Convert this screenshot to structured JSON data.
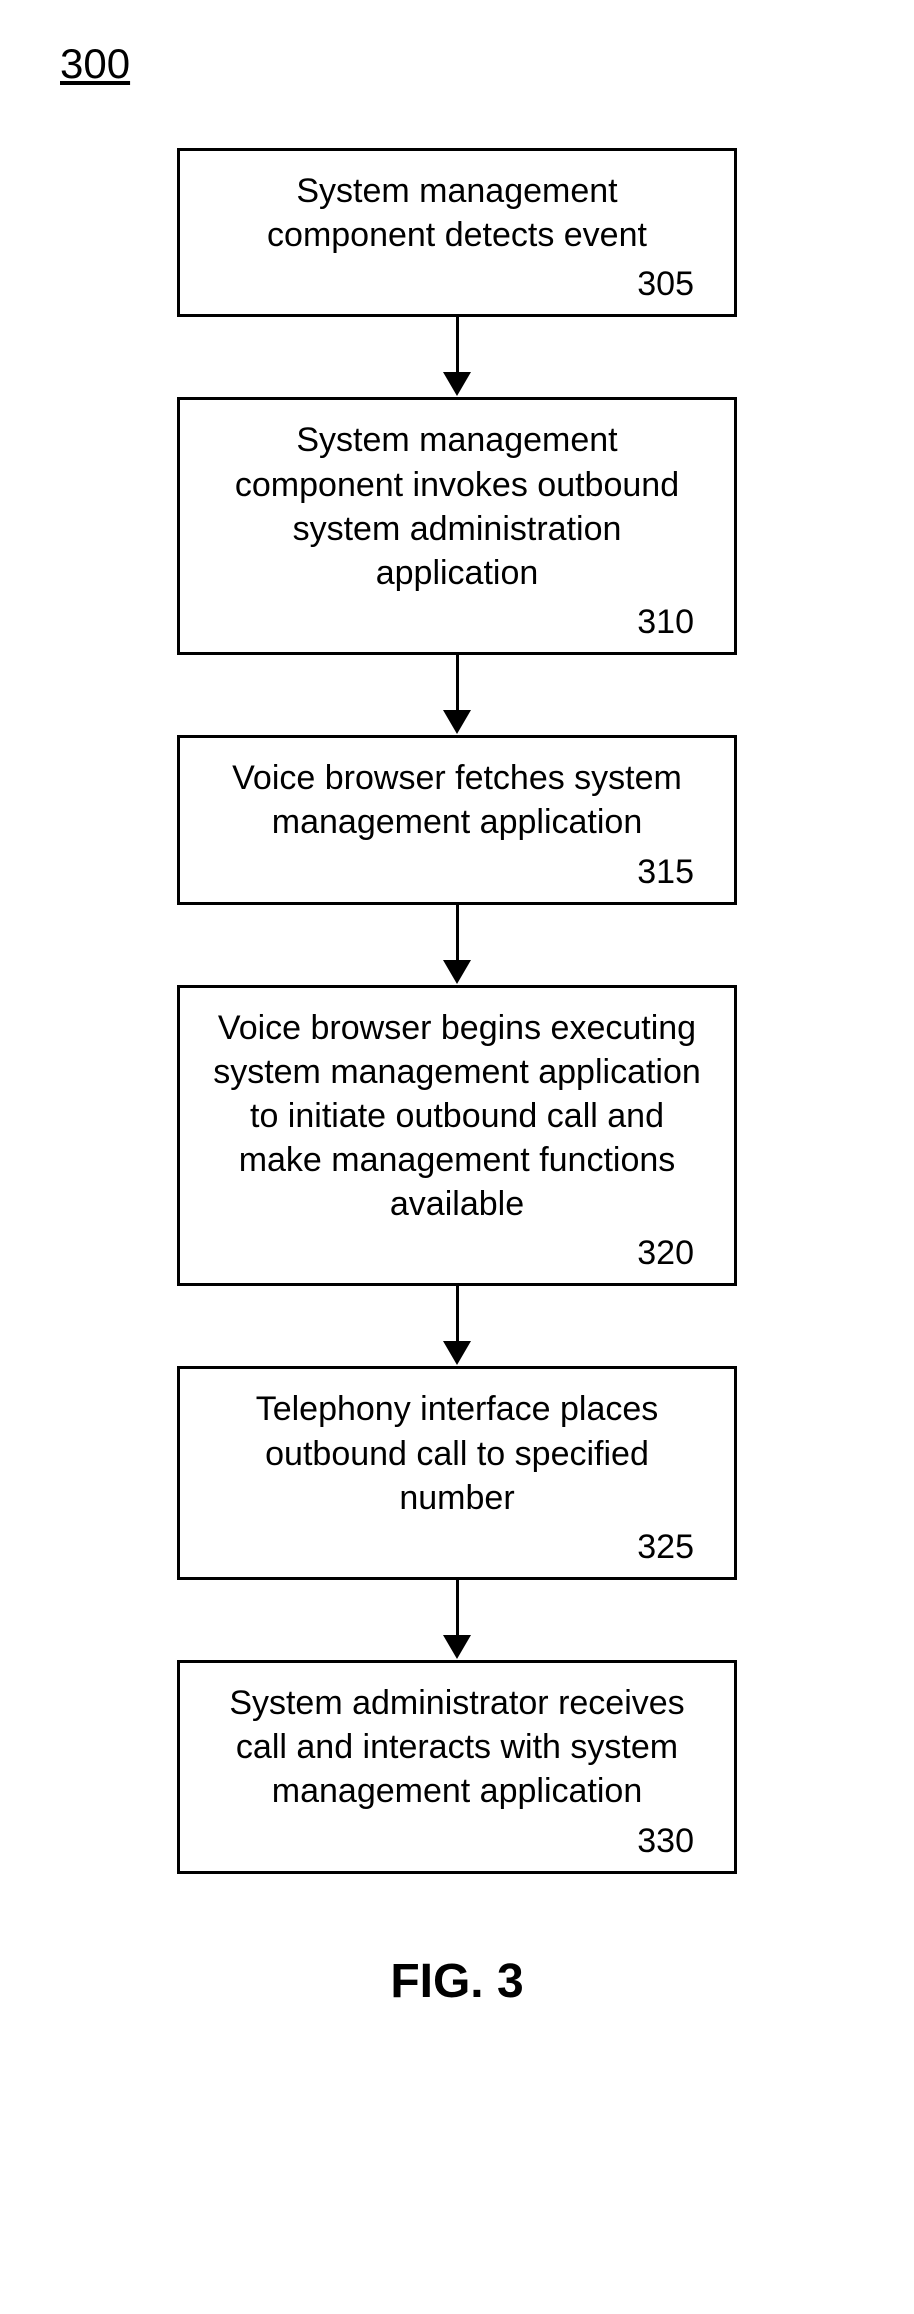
{
  "figure_number": "300",
  "figure_caption": "FIG. 3",
  "steps": [
    {
      "text": "System management component detects event",
      "number": "305"
    },
    {
      "text": "System management component invokes outbound system administration application",
      "number": "310"
    },
    {
      "text": "Voice browser fetches system management application",
      "number": "315"
    },
    {
      "text": "Voice browser begins executing system management application to initiate outbound call and make management functions available",
      "number": "320"
    },
    {
      "text": "Telephony interface places outbound call to specified number",
      "number": "325"
    },
    {
      "text": "System administrator receives call and interacts with system management application",
      "number": "330"
    }
  ]
}
